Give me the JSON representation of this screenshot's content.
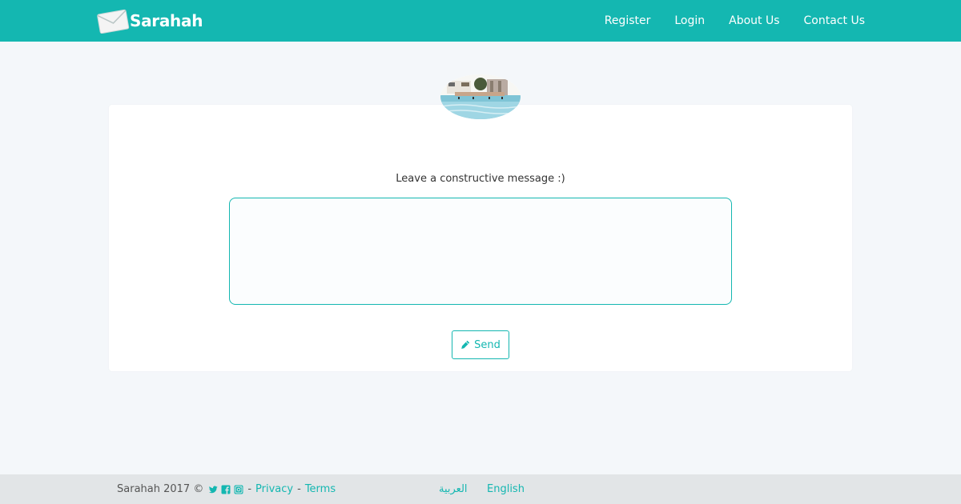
{
  "header": {
    "brand": "Sarahah",
    "nav": [
      {
        "label": "Register"
      },
      {
        "label": "Login"
      },
      {
        "label": "About Us"
      },
      {
        "label": "Contact Us"
      }
    ]
  },
  "main": {
    "prompt": "Leave a constructive message :)",
    "message_value": "",
    "send_label": "Send"
  },
  "footer": {
    "copyright": "Sarahah 2017 ©",
    "separator": "-",
    "privacy": "Privacy",
    "terms": "Terms",
    "lang_ar": "العربية",
    "lang_en": "English"
  },
  "colors": {
    "accent": "#14b7b1",
    "page_bg": "#f4f7fa",
    "footer_bg": "#e2e5e7"
  },
  "icons": {
    "logo": "envelope-icon",
    "send": "pencil-icon",
    "social": [
      "twitter-icon",
      "facebook-icon",
      "instagram-icon"
    ]
  }
}
